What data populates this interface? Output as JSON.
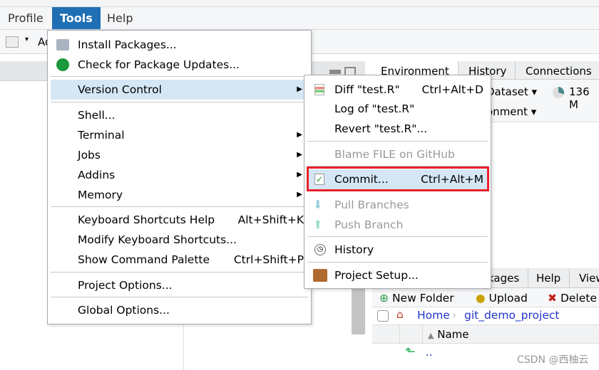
{
  "menubar": {
    "items": [
      "Profile",
      "Tools",
      "Help"
    ],
    "active": "Tools"
  },
  "toolbar": {
    "addins_partial": "Ad"
  },
  "env_pane": {
    "tabs": [
      "Environment",
      "History",
      "Connections"
    ],
    "dataset": "Dataset",
    "memory": "136 M",
    "environment": "ironment"
  },
  "files_pane": {
    "tabs": [
      "kages",
      "Help",
      "View"
    ],
    "new_folder": "New Folder",
    "upload": "Upload",
    "delete": "Delete",
    "home": "Home",
    "project": "git_demo_project",
    "name_col": "Name",
    "parent": ".."
  },
  "tools_menu": {
    "items": [
      {
        "label": "Install Packages...",
        "icon": "install-packages-icon"
      },
      {
        "label": "Check for Package Updates...",
        "icon": "refresh-icon"
      },
      {
        "label": "Version Control",
        "submenu": true
      },
      {
        "label": "Shell..."
      },
      {
        "label": "Terminal",
        "submenu": true
      },
      {
        "label": "Jobs",
        "submenu": true
      },
      {
        "label": "Addins",
        "submenu": true
      },
      {
        "label": "Memory",
        "submenu": true
      },
      {
        "label": "Keyboard Shortcuts Help",
        "shortcut": "Alt+Shift+K"
      },
      {
        "label": "Modify Keyboard Shortcuts..."
      },
      {
        "label": "Show Command Palette",
        "shortcut": "Ctrl+Shift+P"
      },
      {
        "label": "Project Options..."
      },
      {
        "label": "Global Options..."
      }
    ]
  },
  "vc_menu": {
    "items": [
      {
        "label": "Diff \"test.R\"",
        "shortcut": "Ctrl+Alt+D"
      },
      {
        "label": "Log of \"test.R\""
      },
      {
        "label": "Revert \"test.R\"..."
      },
      {
        "label": "Blame FILE on GitHub",
        "disabled": true
      },
      {
        "label": "Commit...",
        "shortcut": "Ctrl+Alt+M",
        "highlighted": true
      },
      {
        "label": "Pull Branches",
        "disabled": true
      },
      {
        "label": "Push Branch",
        "disabled": true
      },
      {
        "label": "History"
      },
      {
        "label": "Project Setup..."
      }
    ]
  },
  "watermark": "CSDN @西柚云",
  "colors": {
    "accent": "#1f6fb5",
    "highlight": "#d5e6f5",
    "callout": "#e8202a"
  }
}
